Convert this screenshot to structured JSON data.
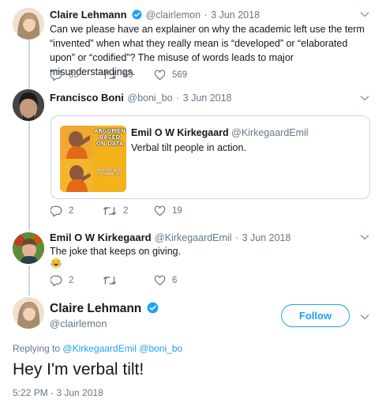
{
  "colors": {
    "accent": "#1da1f2",
    "text": "#14171a",
    "muted": "#657786",
    "border": "#ccd6dd"
  },
  "tweet1": {
    "name": "Claire Lehmann",
    "handle": "@clairlemon",
    "date": "3 Jun 2018",
    "text": "Can we please have an explainer on why the academic left use the term “invented” when what they really mean is “developed” or “elaborated upon” or “codified”? The misuse of words leads to major misunderstandings.",
    "replies": "85",
    "retweets": "69",
    "likes": "569"
  },
  "tweet2": {
    "name": "Francisco Boni",
    "handle": "@boni_bo",
    "date": "3 Jun 2018",
    "quote": {
      "name": "Emil O W Kirkegaard",
      "handle": "@KirkegaardEmil",
      "text": "Verbal tilt people in action.",
      "meme_top": "ARGUMENT BASED ON DATA",
      "meme_bottom": "ARGUMENT BASED ON VERBAL TILT"
    },
    "replies": "2",
    "retweets": "2",
    "likes": "19"
  },
  "tweet3": {
    "name": "Emil O W Kirkegaard",
    "handle": "@KirkegaardEmil",
    "date": "3 Jun 2018",
    "text": "The joke that keeps on giving.",
    "emoji": "😂",
    "replies": "2",
    "retweets": "",
    "likes": "6"
  },
  "main": {
    "name": "Claire Lehmann",
    "handle": "@clairlemon",
    "follow_label": "Follow",
    "replying_prefix": "Replying to",
    "replying_to": "@KirkegaardEmil @boni_bo",
    "text": "Hey I'm verbal tilt!",
    "timestamp": "5:22 PM - 3 Jun 2018"
  }
}
